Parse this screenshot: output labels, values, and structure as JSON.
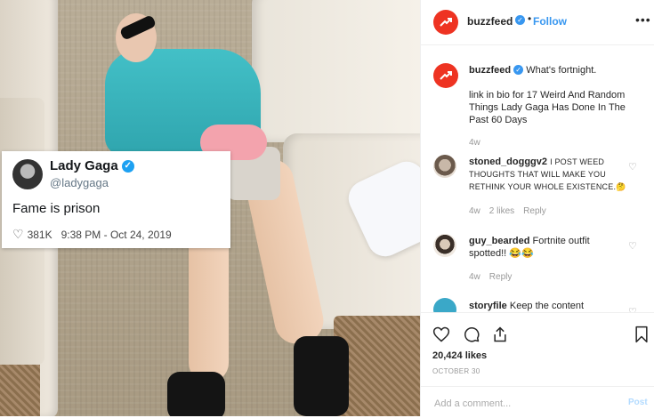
{
  "header": {
    "username": "buzzfeed",
    "verified_glyph": "✓",
    "separator": "•",
    "follow_label": "Follow",
    "more_icon": "more-dots-icon"
  },
  "tweet": {
    "name": "Lady Gaga",
    "handle": "@ladygaga",
    "text": "Fame is prison",
    "likes": "381K",
    "timestamp": "9:38 PM - Oct 24, 2019"
  },
  "caption": {
    "username": "buzzfeed",
    "text": "What's fortnight.",
    "link_text": "link in bio for 17 Weird And Random Things Lady Gaga Has Done In The Past 60 Days",
    "ago": "4w"
  },
  "comments": [
    {
      "username": "stoned_dogggv2",
      "text": "I POST WEED THOUGHTS THAT WILL MAKE YOU RETHINK YOUR WHOLE EXISTENCE.🤔",
      "ago": "4w",
      "likes": "2 likes",
      "reply": "Reply"
    },
    {
      "username": "guy_bearded",
      "text": "Fortnite outfit spotted!! 😂😂",
      "ago": "4w",
      "reply": "Reply"
    },
    {
      "username": "storyfile",
      "text": "Keep the content"
    }
  ],
  "footer": {
    "likes": "20,424 likes",
    "date": "OCTOBER 30",
    "comment_placeholder": "Add a comment...",
    "post_label": "Post"
  },
  "colors": {
    "brand": "#ee3322",
    "link": "#3897f0",
    "twitter_blue": "#1da1f2"
  }
}
